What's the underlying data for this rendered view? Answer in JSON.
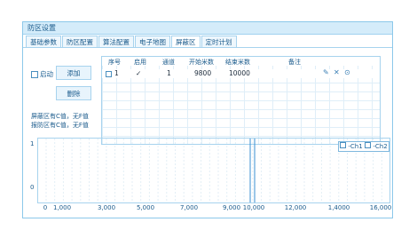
{
  "window": {
    "title": "防区设置"
  },
  "tabs": [
    "基础参数",
    "防区配置",
    "算法配置",
    "电子地图",
    "屏蔽区",
    "定时计划"
  ],
  "active_tab": "屏蔽区",
  "controls": {
    "enable_label": "启动",
    "add_label": "添加",
    "delete_label": "删除",
    "note_shield": "屏蔽区有C值，无F值",
    "note_alarm": "报防区有C值，无F值"
  },
  "table": {
    "headers": [
      "序号",
      "启用",
      "通道",
      "开始米数",
      "结束米数",
      "备注"
    ],
    "rows": [
      {
        "index": "1",
        "enabled": "✓",
        "channel": "1",
        "start": "9800",
        "end": "10000",
        "note": ""
      }
    ],
    "actions": [
      "edit-icon",
      "delete-icon",
      "locate-icon"
    ]
  },
  "chart_data": {
    "type": "line",
    "series": [
      {
        "name": "Ch1"
      },
      {
        "name": "Ch2"
      }
    ],
    "x_ticks": [
      "0",
      "1,000",
      "3,000",
      "5,000",
      "7,000",
      "9,000",
      "10,000",
      "12,000",
      "1,4000",
      "16,000"
    ],
    "xlim": [
      0,
      16000
    ],
    "y_ticks": [
      "1",
      "0"
    ],
    "ylim": [
      0,
      1
    ],
    "shield_region": [
      9800,
      10000
    ],
    "grid": true,
    "legend_position": "top-right",
    "colors": {
      "marker": "#3a8fd0",
      "grid": "#e3eef6"
    }
  }
}
